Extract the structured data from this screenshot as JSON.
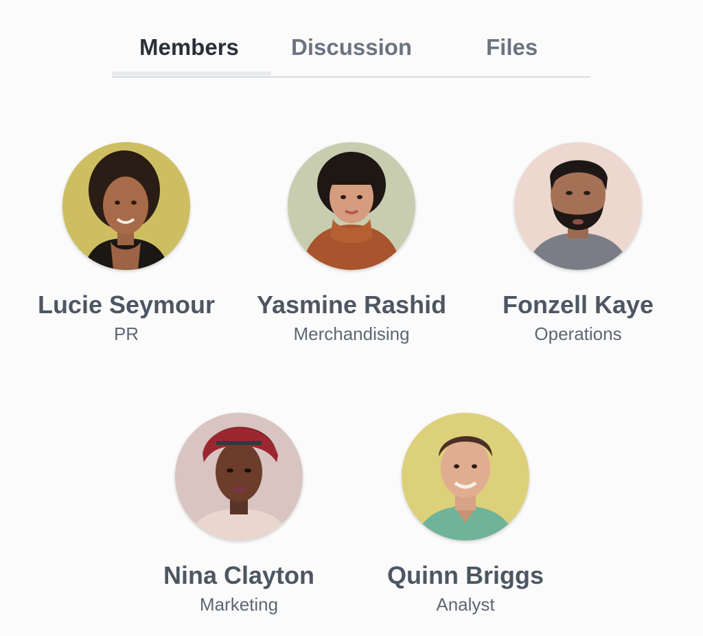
{
  "tabs": [
    {
      "label": "Members",
      "active": true
    },
    {
      "label": "Discussion",
      "active": false
    },
    {
      "label": "Files",
      "active": false
    }
  ],
  "members": [
    {
      "name": "Lucie Seymour",
      "role": "PR",
      "avatar_icon": "avatar-photo",
      "bg_color": "#c9b85a"
    },
    {
      "name": "Yasmine Rashid",
      "role": "Merchandising",
      "avatar_icon": "avatar-photo",
      "bg_color": "#c8cdb0"
    },
    {
      "name": "Fonzell Kaye",
      "role": "Operations",
      "avatar_icon": "avatar-photo",
      "bg_color": "#ecd8cf"
    },
    {
      "name": "Nina Clayton",
      "role": "Marketing",
      "avatar_icon": "avatar-photo",
      "bg_color": "#d8c4c0"
    },
    {
      "name": "Quinn Briggs",
      "role": "Analyst",
      "avatar_icon": "avatar-photo",
      "bg_color": "#dcd07a"
    }
  ]
}
